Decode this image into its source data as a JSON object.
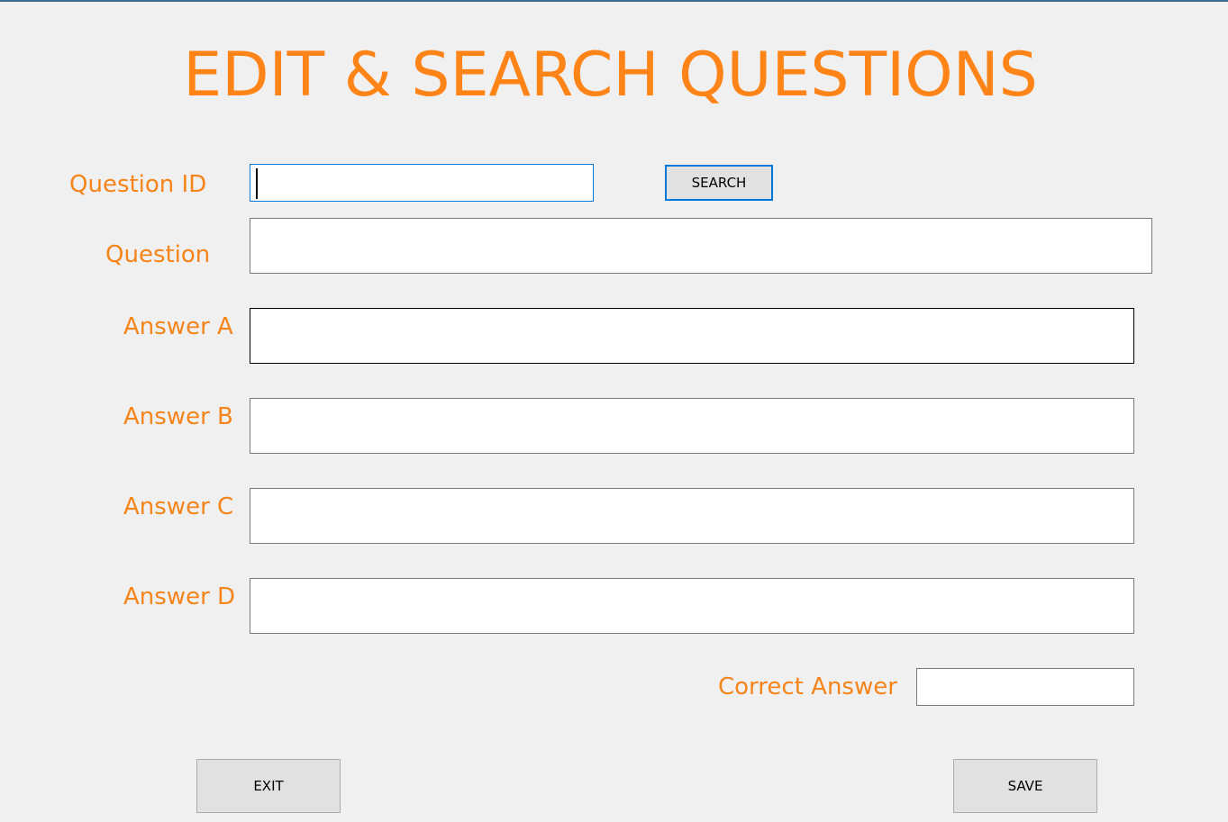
{
  "form": {
    "title": "EDIT & SEARCH QUESTIONS",
    "question_id": {
      "label": "Question ID",
      "value": ""
    },
    "search_button": "SEARCH",
    "question": {
      "label": "Question",
      "value": ""
    },
    "answer_a": {
      "label": "Answer A",
      "value": ""
    },
    "answer_b": {
      "label": "Answer B",
      "value": ""
    },
    "answer_c": {
      "label": "Answer C",
      "value": ""
    },
    "answer_d": {
      "label": "Answer D",
      "value": ""
    },
    "correct_answer": {
      "label": "Correct Answer",
      "value": ""
    },
    "exit_button": "EXIT",
    "save_button": "SAVE"
  },
  "colors": {
    "label": "#f5841a",
    "title": "#ff8418",
    "background": "#f0f0f0",
    "focus_border": "#0078d7"
  }
}
